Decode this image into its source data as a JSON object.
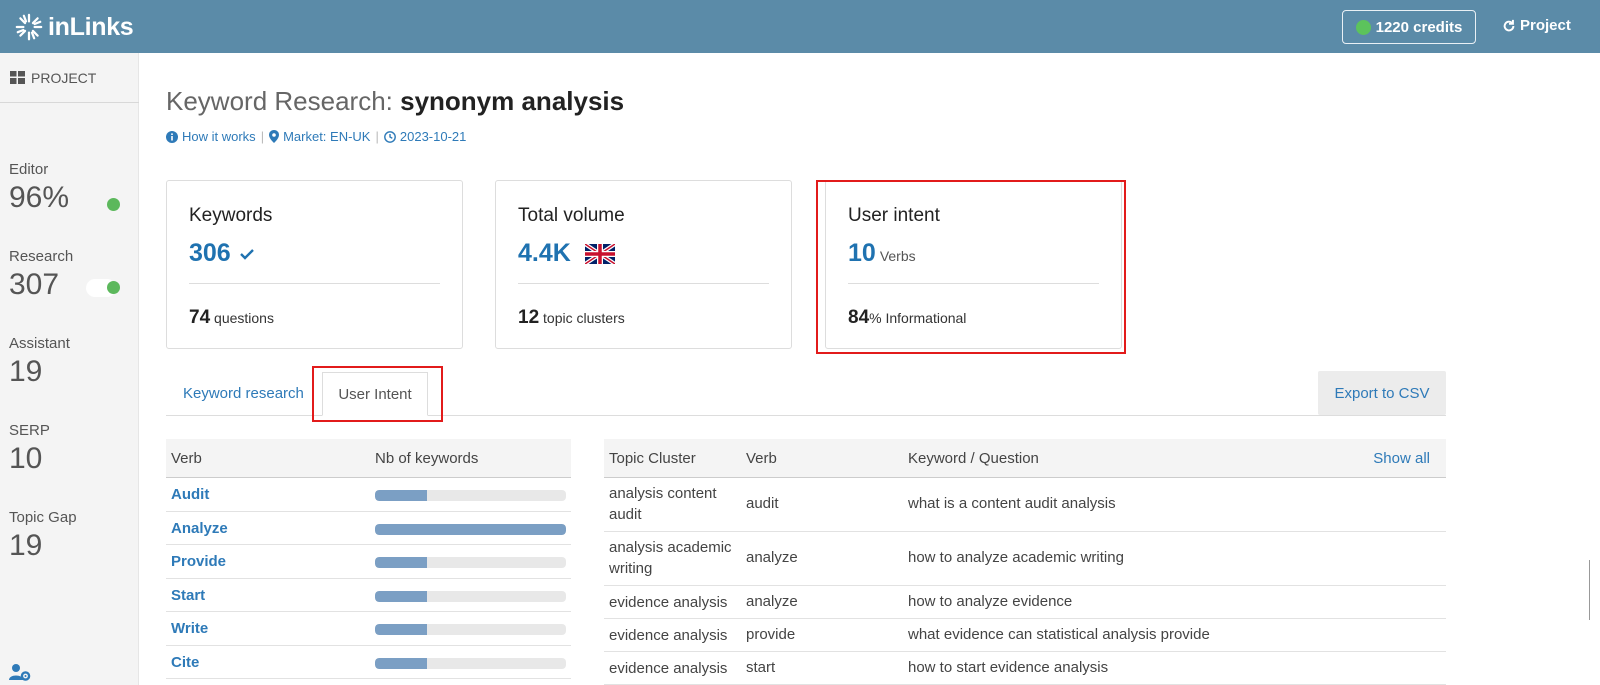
{
  "app": {
    "logo_text": "inLinks",
    "credits_label": "1220 credits",
    "project_label": "Project"
  },
  "sidebar": {
    "header": "PROJECT",
    "stats": [
      {
        "label": "Editor",
        "value": "96%"
      },
      {
        "label": "Research",
        "value": "307"
      },
      {
        "label": "Assistant",
        "value": "19"
      },
      {
        "label": "SERP",
        "value": "10"
      },
      {
        "label": "Topic Gap",
        "value": "19"
      }
    ]
  },
  "page": {
    "title_prefix": "Keyword Research: ",
    "title_keyword": "synonym analysis",
    "meta": {
      "how": "How it works",
      "market": "Market: EN-UK",
      "date": "2023-10-21"
    }
  },
  "cards": [
    {
      "title": "Keywords",
      "big": "306",
      "big_suffix": "",
      "foot_num": "74",
      "foot_text": " questions"
    },
    {
      "title": "Total volume",
      "big": "4.4K",
      "big_suffix": "",
      "foot_num": "12",
      "foot_text": " topic clusters"
    },
    {
      "title": "User intent",
      "big": "10",
      "big_suffix": "Verbs",
      "foot_num": "84",
      "foot_text": "% Informational"
    }
  ],
  "tabs": {
    "keyword_research": "Keyword research",
    "user_intent": "User Intent",
    "export": "Export to CSV"
  },
  "verb_table": {
    "headers": [
      "Verb",
      "Nb of keywords"
    ],
    "rows": [
      {
        "verb": "Audit",
        "fraction": 0.27
      },
      {
        "verb": "Analyze",
        "fraction": 1.0
      },
      {
        "verb": "Provide",
        "fraction": 0.27
      },
      {
        "verb": "Start",
        "fraction": 0.27
      },
      {
        "verb": "Write",
        "fraction": 0.27
      },
      {
        "verb": "Cite",
        "fraction": 0.27
      }
    ]
  },
  "cluster_table": {
    "headers": [
      "Topic Cluster",
      "Verb",
      "Keyword / Question"
    ],
    "show_all": "Show all",
    "rows": [
      {
        "cluster": "analysis content audit",
        "verb": "audit",
        "keyword": "what is a content audit analysis"
      },
      {
        "cluster": "analysis academic writing",
        "verb": "analyze",
        "keyword": "how to analyze academic writing"
      },
      {
        "cluster": "evidence analysis",
        "verb": "analyze",
        "keyword": "how to analyze evidence"
      },
      {
        "cluster": "evidence analysis",
        "verb": "provide",
        "keyword": "what evidence can statistical analysis provide"
      },
      {
        "cluster": "evidence analysis",
        "verb": "start",
        "keyword": "how to start evidence analysis"
      }
    ]
  },
  "colors": {
    "topbar": "#5b8ba8",
    "accent": "#2e7ab8",
    "highlight": "#e21b1b",
    "status_green": "#5cb85c",
    "bar_fill": "#7b9fc4"
  }
}
